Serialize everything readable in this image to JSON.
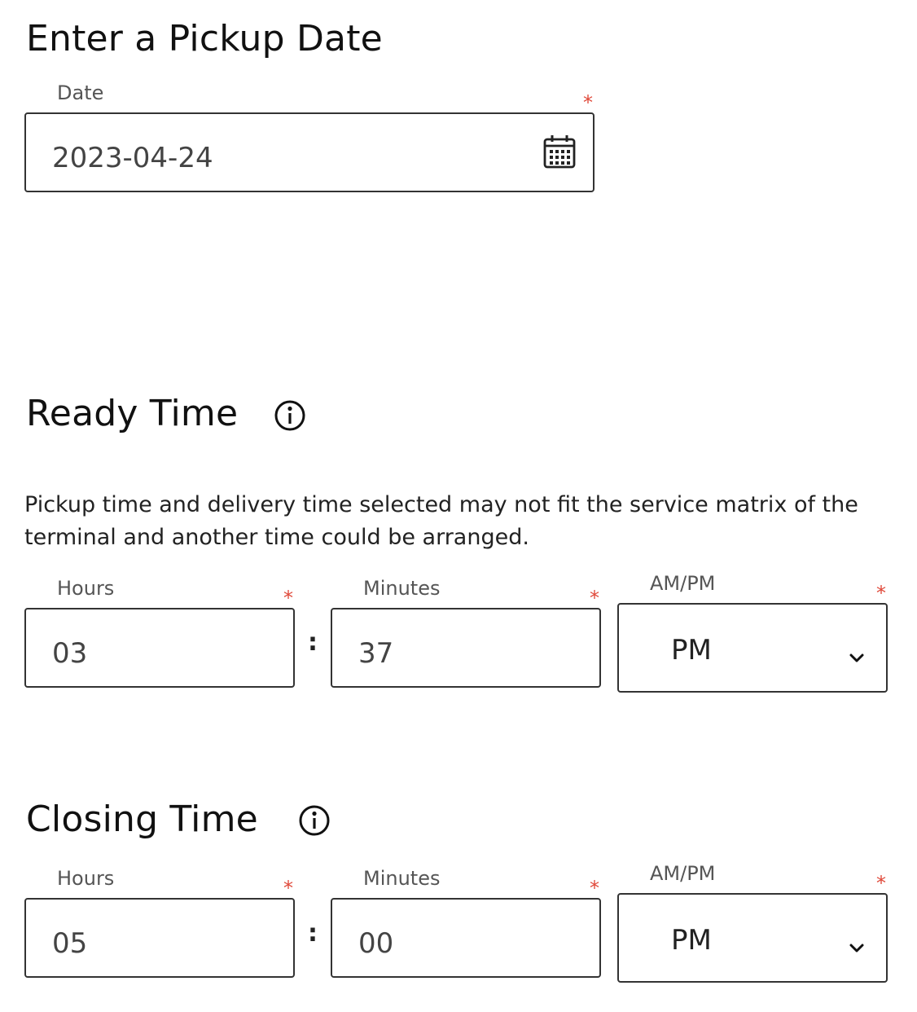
{
  "pickup_date": {
    "title": "Enter a Pickup Date",
    "date_label": "Date",
    "required_mark": "*",
    "date_value": "2023-04-24",
    "calendar_icon": "calendar-icon"
  },
  "ready_time": {
    "title": "Ready Time",
    "info_icon": "info-icon",
    "description": "Pickup time and delivery time selected may not fit the service matrix of the terminal and another time could be arranged.",
    "hours_label": "Hours",
    "minutes_label": "Minutes",
    "ampm_label": "AM/PM",
    "required_mark": "*",
    "separator": ":",
    "hours_value": "03",
    "minutes_value": "37",
    "ampm_value": "PM",
    "chevron_icon": "chevron-down-icon"
  },
  "closing_time": {
    "title": "Closing Time",
    "info_icon": "info-icon",
    "hours_label": "Hours",
    "minutes_label": "Minutes",
    "ampm_label": "AM/PM",
    "required_mark": "*",
    "separator": ":",
    "hours_value": "05",
    "minutes_value": "00",
    "ampm_value": "PM",
    "chevron_icon": "chevron-down-icon"
  },
  "colors": {
    "required": "#e0493a",
    "border": "#333333",
    "label": "#555555"
  }
}
